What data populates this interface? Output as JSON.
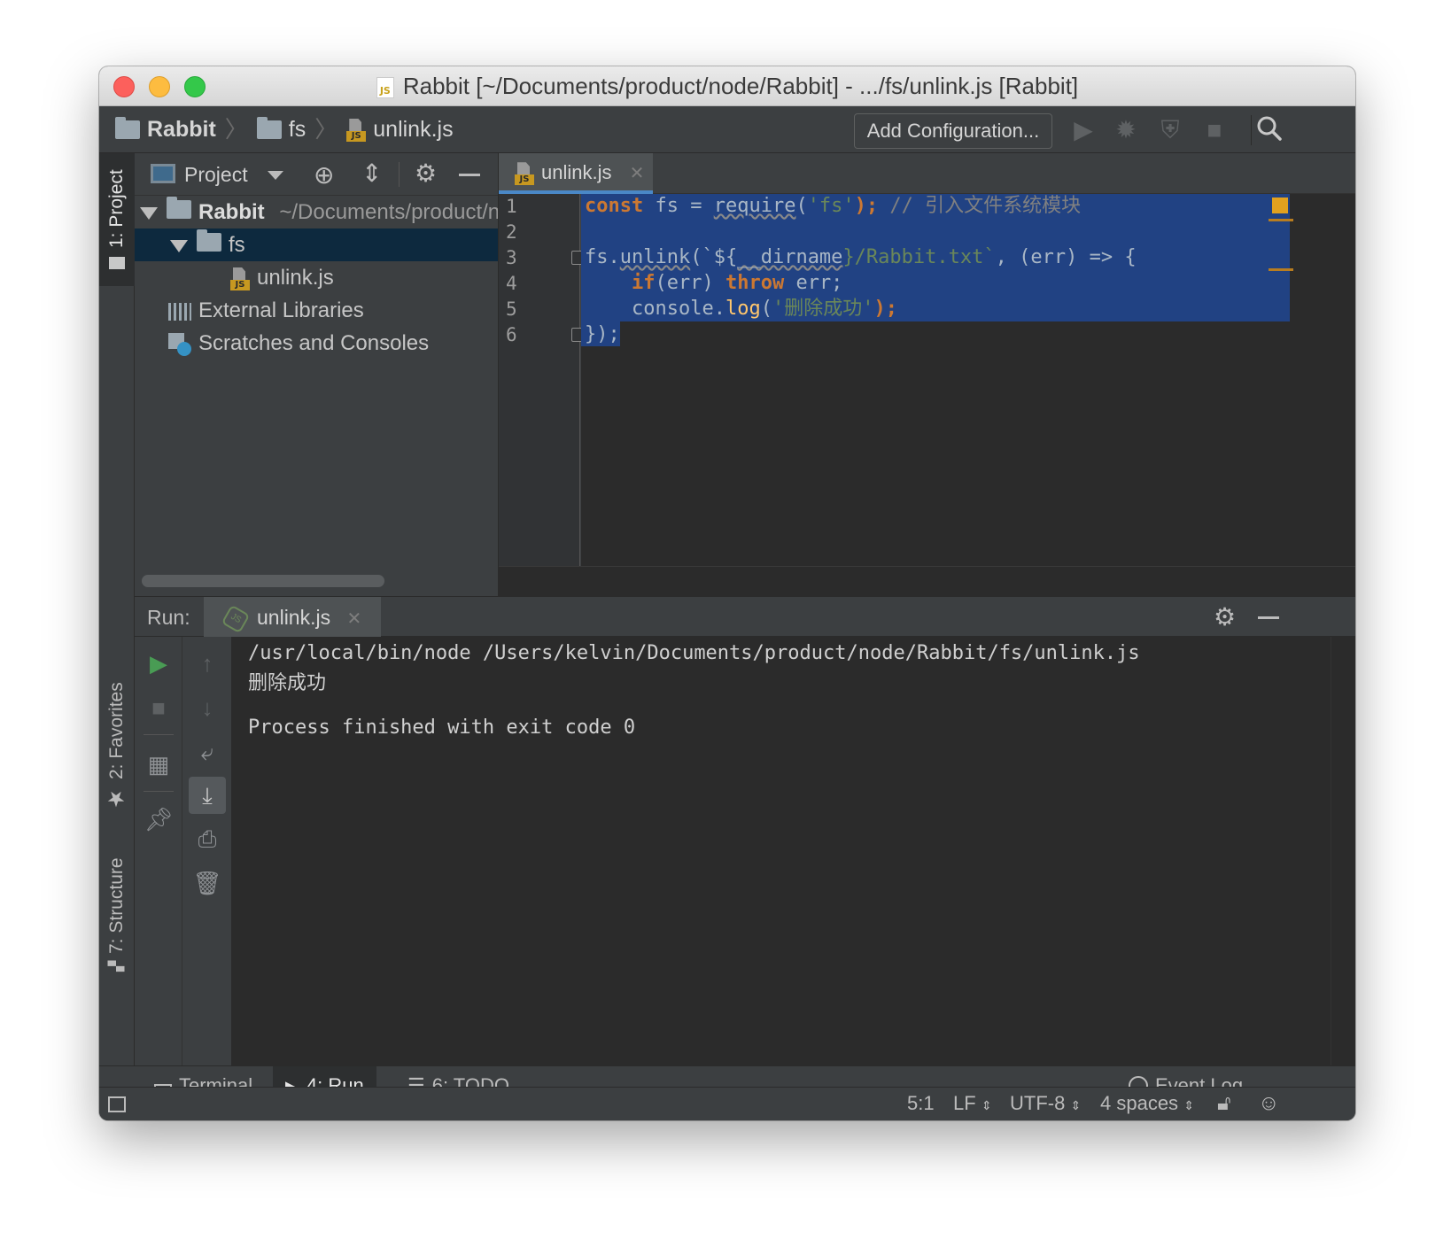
{
  "window": {
    "title": "Rabbit [~/Documents/product/node/Rabbit] - .../fs/unlink.js [Rabbit]"
  },
  "navbar": {
    "breadcrumb": [
      "Rabbit",
      "fs",
      "unlink.js"
    ],
    "add_config_label": "Add Configuration...",
    "icons": [
      "run-icon",
      "debug-icon",
      "coverage-icon",
      "stop-icon",
      "search-icon"
    ]
  },
  "left_stripe": {
    "project_tab": "1: Project",
    "favorites_tab": "2: Favorites",
    "structure_tab": "7: Structure"
  },
  "project_panel": {
    "view_label": "Project",
    "tree": {
      "root_name": "Rabbit",
      "root_path": "~/Documents/product/node/Rabbit",
      "folder": "fs",
      "file": "unlink.js",
      "external_libraries": "External Libraries",
      "scratches": "Scratches and Consoles"
    }
  },
  "editor": {
    "tab_label": "unlink.js",
    "line_numbers": [
      "1",
      "2",
      "3",
      "4",
      "5",
      "6"
    ],
    "code": {
      "l1_kw": "const",
      "l1_a": " fs = ",
      "l1_fn": "require",
      "l1_b": "(",
      "l1_str": "'fs'",
      "l1_c": ");",
      "l1_cmt": " // 引入文件系统模块",
      "l3_a": "fs.",
      "l3_fn": "unlink",
      "l3_b": "(`${",
      "l3_dirname": "__dirname",
      "l3_tpl": "}/Rabbit.txt`",
      "l3_c": ", (err) => {",
      "l4_indent": "    ",
      "l4_kw1": "if",
      "l4_a": "(err) ",
      "l4_kw2": "throw",
      "l4_b": " err;",
      "l5_a": "    console.",
      "l5_fn": "log",
      "l5_b": "(",
      "l5_str": "'删除成功'",
      "l5_c": ");",
      "l6": "});"
    }
  },
  "run_panel": {
    "label": "Run:",
    "tab_label": "unlink.js",
    "console": {
      "command": "/usr/local/bin/node /Users/kelvin/Documents/product/node/Rabbit/fs/unlink.js",
      "output": "删除成功",
      "exit": "Process finished with exit code 0"
    }
  },
  "bottom_tools": {
    "terminal": "Terminal",
    "run_num": "4",
    "run_label": ": Run",
    "todo_num": "6",
    "todo_label": ": TODO",
    "event_log": "Event Log"
  },
  "status_bar": {
    "position": "5:1",
    "line_sep": "LF",
    "encoding": "UTF-8",
    "indent": "4 spaces"
  },
  "colors": {
    "selection": "#214283",
    "keyword": "#cc7832",
    "string": "#6a8759",
    "function": "#ffc66d",
    "run_green": "#499c54"
  }
}
